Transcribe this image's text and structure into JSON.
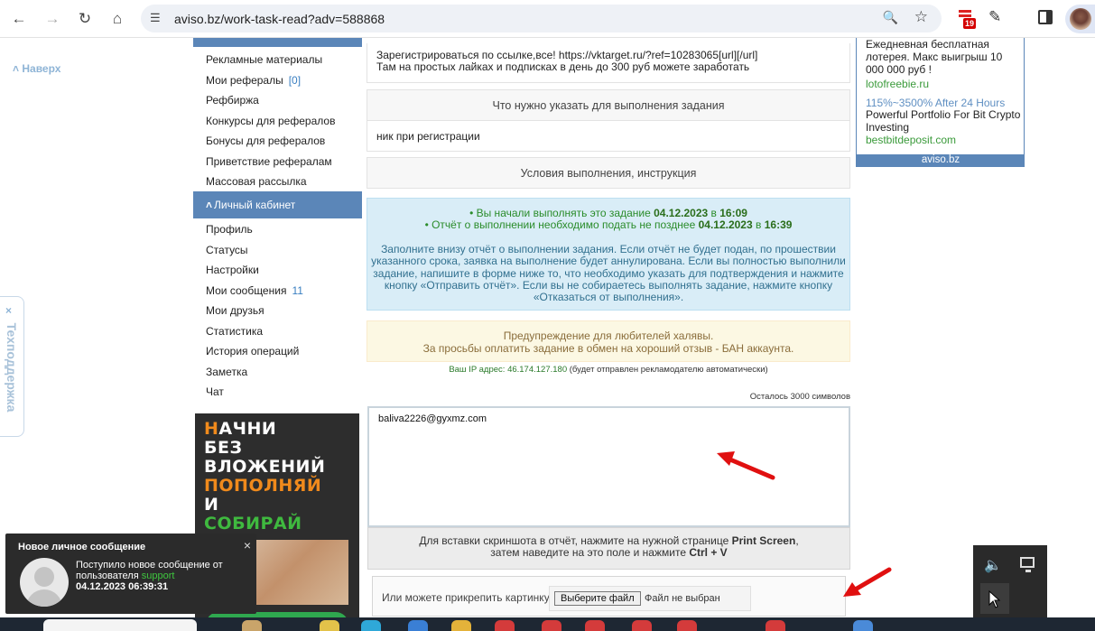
{
  "browser": {
    "url": "aviso.bz/work-task-read?adv=588868",
    "ext_badge": "19"
  },
  "page": {
    "naverh": "Наверх",
    "support_close": "×",
    "support_label": "Техподдержка"
  },
  "menu": {
    "items_top": [
      {
        "label": "Рекламные материалы",
        "count": ""
      },
      {
        "label": "Мои рефералы",
        "count": "[0]"
      },
      {
        "label": "Рефбиржа",
        "count": ""
      },
      {
        "label": "Конкурсы для рефералов",
        "count": ""
      },
      {
        "label": "Бонусы для рефералов",
        "count": ""
      },
      {
        "label": "Приветствие рефералам",
        "count": ""
      },
      {
        "label": "Массовая рассылка",
        "count": ""
      }
    ],
    "cabinet_header": "Личный кабинет",
    "items_cabinet": [
      {
        "label": "Профиль",
        "count": ""
      },
      {
        "label": "Статусы",
        "count": ""
      },
      {
        "label": "Настройки",
        "count": ""
      },
      {
        "label": "Мои сообщения",
        "count": "11"
      },
      {
        "label": "Мои друзья",
        "count": ""
      },
      {
        "label": "Статистика",
        "count": ""
      },
      {
        "label": "История операций",
        "count": ""
      },
      {
        "label": "Заметка",
        "count": ""
      },
      {
        "label": "Чат",
        "count": ""
      }
    ]
  },
  "banner": {
    "lines": [
      {
        "parts": [
          [
            "o",
            "Н"
          ],
          [
            "w",
            "АЧНИ"
          ]
        ]
      },
      {
        "parts": [
          [
            "w",
            "БЕЗ"
          ]
        ]
      },
      {
        "parts": [
          [
            "w",
            "ВЛОЖЕНИЙ"
          ]
        ]
      },
      {
        "parts": [
          [
            "o",
            "ПОПОЛНЯЙ"
          ]
        ]
      },
      {
        "parts": [
          [
            "w",
            "И"
          ]
        ]
      },
      {
        "parts": [
          [
            "g",
            "СОБИРАЙ"
          ]
        ]
      }
    ]
  },
  "notification": {
    "title": "Новое личное сообщение",
    "close": "×",
    "line1": "Поступило новое сообщение от",
    "line2_prefix": "пользователя",
    "user": "support",
    "date": "04.12.2023 06:39:31"
  },
  "task": {
    "desc_line1": "Зарегистрироваться по ссылке,все! https://vktarget.ru/?ref=10283065[url][/url]",
    "desc_line2": "Там на простых лайках и подписках в день до 300 руб можете заработать",
    "what_header": "Что нужно указать для выполнения задания",
    "what_value": "ник при регистрации",
    "conditions_header": "Условия выполнения, инструкция",
    "info": {
      "l1_prefix": "• Вы начали выполнять это задание",
      "l1_date": "04.12.2023",
      "l1_mid": "в",
      "l1_time": "16:09",
      "l2_prefix": "• Отчёт о выполнении необходимо подать не позднее",
      "l2_date": "04.12.2023",
      "l2_mid": "в",
      "l2_time": "16:39",
      "p1": "Заполните внизу отчёт о выполнении задания. Если отчёт не будет подан, по прошествии",
      "p2": "указанного срока, заявка на выполнение будет аннулирована. Если вы полностью выполнили",
      "p3": "задание, напишите в форме ниже то, что необходимо указать для подтверждения и нажмите",
      "p4": "кнопку «Отправить отчёт». Если вы не собираетесь выполнять задание, нажмите кнопку",
      "p5": "«Отказаться от выполнения»."
    },
    "warn_line1": "Предупреждение для любителей халявы.",
    "warn_line2": "За просьбы оплатить задание в обмен на хороший отзыв - БАН аккаунта.",
    "ip_prefix": "Ваш IP адрес:",
    "ip": "46.174.127.180",
    "ip_suffix": "(будет отправлен рекламодателю автоматически)",
    "remaining": "Осталось 3000 символов",
    "report_value": "baliva2226@gyxmz.com",
    "paste_line1_prefix": "Для вставки скриншота в отчёт, нажмите на нужной странице",
    "paste_key1": "Print Screen",
    "paste_line2_prefix": "затем наведите на это поле и нажмите",
    "paste_key2": "Ctrl + V",
    "attach_label": "Или можете прикрепить картинку",
    "choose_file": "Выберите файл",
    "no_file": "Файл не выбран"
  },
  "ad": {
    "text1": "Ежедневная бесплатная лотерея. Макс выигрыш 10 000 000 руб !",
    "link1": "lotofreebie.ru",
    "heading2": "115%~3500% After 24 Hours",
    "text2": "Powerful Portfolio For Bit Crypto Investing",
    "link2": "bestbitdeposit.com",
    "footer": "aviso.bz"
  }
}
